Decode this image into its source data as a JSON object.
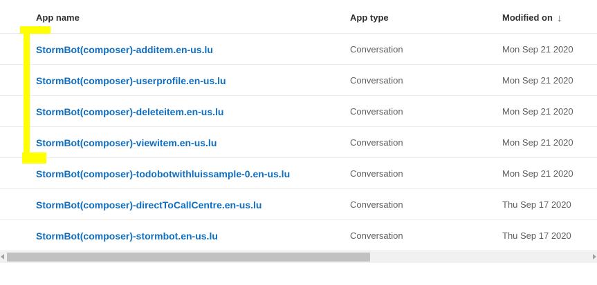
{
  "columns": {
    "app_name": "App name",
    "app_type": "App type",
    "modified_on": "Modified on",
    "sort_icon": "arrow-down-icon",
    "sort_glyph": "↓"
  },
  "rows": [
    {
      "name": "StormBot(composer)-additem.en-us.lu",
      "type": "Conversation",
      "modified": "Mon Sep 21 2020"
    },
    {
      "name": "StormBot(composer)-userprofile.en-us.lu",
      "type": "Conversation",
      "modified": "Mon Sep 21 2020"
    },
    {
      "name": "StormBot(composer)-deleteitem.en-us.lu",
      "type": "Conversation",
      "modified": "Mon Sep 21 2020"
    },
    {
      "name": "StormBot(composer)-viewitem.en-us.lu",
      "type": "Conversation",
      "modified": "Mon Sep 21 2020"
    },
    {
      "name": "StormBot(composer)-todobotwithluissample-0.en-us.lu",
      "type": "Conversation",
      "modified": "Mon Sep 21 2020"
    },
    {
      "name": "StormBot(composer)-directToCallCentre.en-us.lu",
      "type": "Conversation",
      "modified": "Thu Sep 17 2020"
    },
    {
      "name": "StormBot(composer)-stormbot.en-us.lu",
      "type": "Conversation",
      "modified": "Thu Sep 17 2020"
    }
  ],
  "colors": {
    "link": "#106ebe",
    "highlight": "#ffff00",
    "divider": "#edebe9"
  },
  "annotation": {
    "type": "yellow-bracket",
    "covers_rows": [
      1,
      2,
      3,
      4
    ]
  }
}
